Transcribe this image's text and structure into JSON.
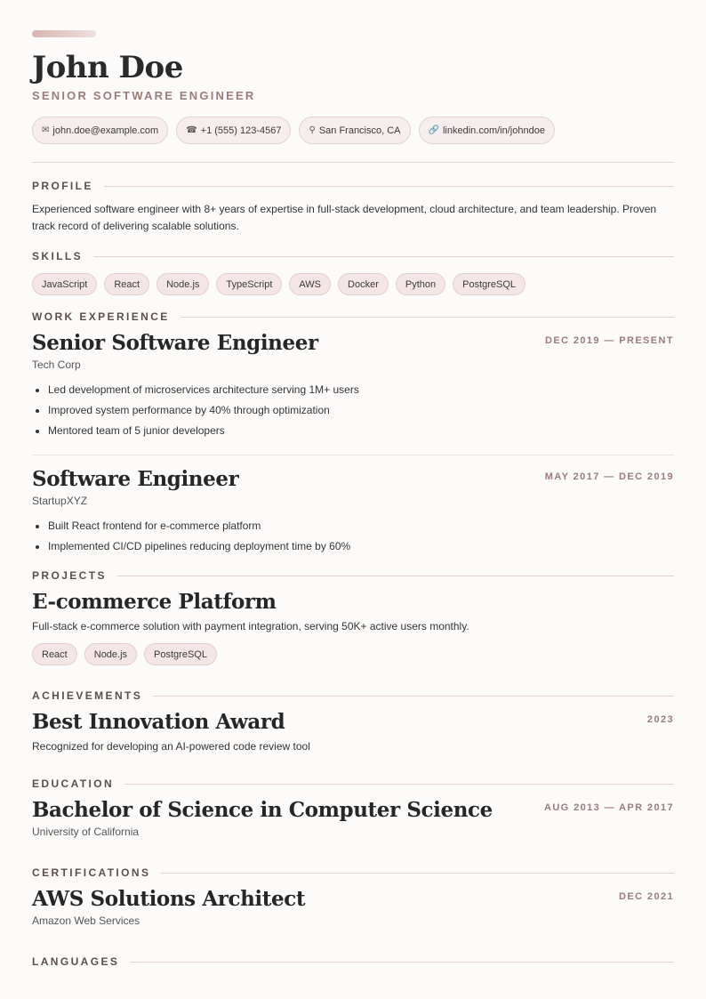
{
  "header": {
    "name": "John Doe",
    "title": "SENIOR SOFTWARE ENGINEER",
    "contacts": [
      {
        "icon": "envelope-icon",
        "glyph": "✉",
        "text": "john.doe@example.com"
      },
      {
        "icon": "phone-icon",
        "glyph": "☎",
        "text": "+1 (555) 123-4567"
      },
      {
        "icon": "location-pin-icon",
        "glyph": "⚲",
        "text": "San Francisco, CA"
      },
      {
        "icon": "link-icon",
        "glyph": "🔗",
        "text": "linkedin.com/in/johndoe"
      }
    ]
  },
  "sections": {
    "profile": "PROFILE",
    "skills": "SKILLS",
    "work": "WORK EXPERIENCE",
    "projects": "PROJECTS",
    "achievements": "ACHIEVEMENTS",
    "education": "EDUCATION",
    "certifications": "CERTIFICATIONS",
    "languages": "LANGUAGES"
  },
  "profile": "Experienced software engineer with 8+ years of expertise in full-stack development, cloud architecture, and team leadership. Proven track record of delivering scalable solutions.",
  "skills": [
    "JavaScript",
    "React",
    "Node.js",
    "TypeScript",
    "AWS",
    "Docker",
    "Python",
    "PostgreSQL"
  ],
  "work": [
    {
      "title": "Senior Software Engineer",
      "date": "DEC 2019 — PRESENT",
      "org": "Tech Corp",
      "bullets": [
        "Led development of microservices architecture serving 1M+ users",
        "Improved system performance by 40% through optimization",
        "Mentored team of 5 junior developers"
      ]
    },
    {
      "title": "Software Engineer",
      "date": "MAY 2017 — DEC 2019",
      "org": "StartupXYZ",
      "bullets": [
        "Built React frontend for e-commerce platform",
        "Implemented CI/CD pipelines reducing deployment time by 60%"
      ]
    }
  ],
  "projects": [
    {
      "title": "E-commerce Platform",
      "description": "Full-stack e-commerce solution with payment integration, serving 50K+ active users monthly.",
      "tags": [
        "React",
        "Node.js",
        "PostgreSQL"
      ]
    }
  ],
  "achievements": [
    {
      "title": "Best Innovation Award",
      "date": "2023",
      "description": "Recognized for developing an AI-powered code review tool"
    }
  ],
  "education": [
    {
      "title": "Bachelor of Science in Computer Science",
      "date": "AUG 2013 — APR 2017",
      "org": "University of California"
    }
  ],
  "certifications": [
    {
      "title": "AWS Solutions Architect",
      "date": "DEC 2021",
      "org": "Amazon Web Services"
    }
  ]
}
